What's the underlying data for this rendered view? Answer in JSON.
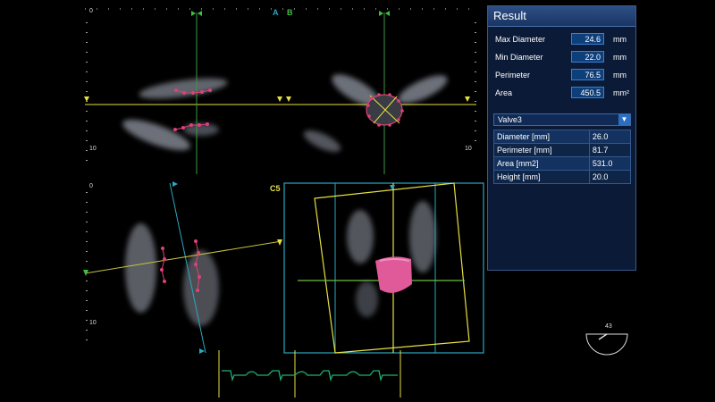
{
  "markers": {
    "letter_a": "A",
    "letter_b": "B",
    "letter_c5": "C5",
    "depth_top_left": "0",
    "depth_mid_left": "10",
    "depth_mid_right": "10",
    "depth_bottom_left": "0",
    "depth_bottom_10": "10",
    "angle": "43"
  },
  "result": {
    "title": "Result",
    "measurements": [
      {
        "label": "Max Diameter",
        "value": "24.6",
        "unit": "mm"
      },
      {
        "label": "Min Diameter",
        "value": "22.0",
        "unit": "mm"
      },
      {
        "label": "Perimeter",
        "value": "76.5",
        "unit": "mm"
      },
      {
        "label": "Area",
        "value": "450.5",
        "unit": "mm²"
      }
    ],
    "valve_select": "Valve3",
    "valve_table": [
      {
        "label": "Diameter [mm]",
        "value": "26.0"
      },
      {
        "label": "Perimeter [mm]",
        "value": "81.7"
      },
      {
        "label": "Area [mm2]",
        "value": "531.0"
      },
      {
        "label": "Height [mm]",
        "value": "20.0"
      }
    ]
  },
  "colors": {
    "yellow_plane": "#e8e040",
    "green_plane": "#40c040",
    "cyan_plane": "#2aa8c0",
    "caliper": "#e0407a",
    "ecg": "#20b070",
    "panel_bg": "#0b1a36"
  }
}
